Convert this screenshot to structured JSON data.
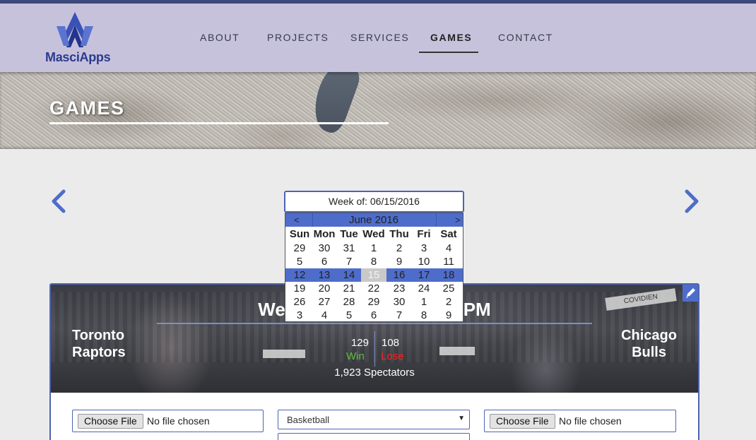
{
  "brand": {
    "name": "MasciApps"
  },
  "nav": {
    "items": [
      {
        "label": "ABOUT"
      },
      {
        "label": "PROJECTS"
      },
      {
        "label": "SERVICES"
      },
      {
        "label": "GAMES"
      },
      {
        "label": "CONTACT"
      }
    ],
    "active": "GAMES"
  },
  "hero": {
    "title": "GAMES"
  },
  "week_picker": {
    "label": "Week of: 06/15/2016",
    "calendar": {
      "prev": "<",
      "next": ">",
      "month": "June 2016",
      "weekdays": [
        "Sun",
        "Mon",
        "Tue",
        "Wed",
        "Thu",
        "Fri",
        "Sat"
      ],
      "weeks": [
        [
          "29",
          "30",
          "31",
          "1",
          "2",
          "3",
          "4"
        ],
        [
          "5",
          "6",
          "7",
          "8",
          "9",
          "10",
          "11"
        ],
        [
          "12",
          "13",
          "14",
          "15",
          "16",
          "17",
          "18"
        ],
        [
          "19",
          "20",
          "21",
          "22",
          "23",
          "24",
          "25"
        ],
        [
          "26",
          "27",
          "28",
          "29",
          "30",
          "1",
          "2"
        ],
        [
          "3",
          "4",
          "5",
          "6",
          "7",
          "8",
          "9"
        ]
      ],
      "selected_week": 2,
      "today": "15"
    }
  },
  "game": {
    "title_left": "Wed",
    "title_right": "PM",
    "home_team": {
      "line1": "Toronto",
      "line2": "Raptors",
      "score": "129",
      "result": "Win"
    },
    "away_team": {
      "line1": "Chicago",
      "line2": "Bulls",
      "score": "108",
      "result": "Lose"
    },
    "spectators": "1,923 Spectators",
    "banners": [
      "COVIDIEN"
    ]
  },
  "form": {
    "file_button": "Choose File",
    "file_status": "No file chosen",
    "sport_selected": "Basketball"
  },
  "colors": {
    "accent": "#4e6dcb",
    "nav_bg": "#c7c2dc",
    "win": "#5fbf3a",
    "lose": "#ff2020"
  }
}
